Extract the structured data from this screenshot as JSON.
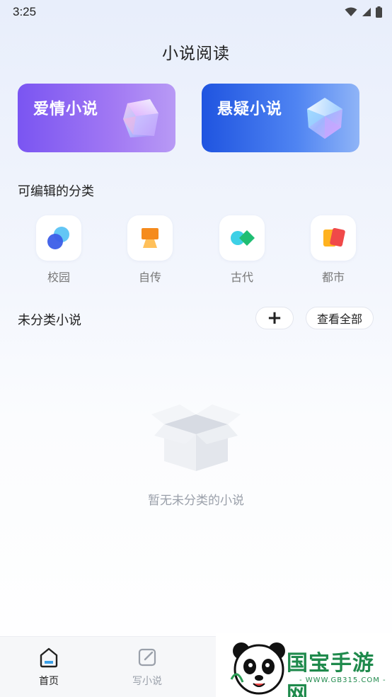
{
  "status_bar": {
    "time": "3:25"
  },
  "header": {
    "title": "小说阅读"
  },
  "hero_cards": [
    {
      "label": "爱情小说"
    },
    {
      "label": "悬疑小说"
    }
  ],
  "editable_categories": {
    "title": "可编辑的分类",
    "items": [
      {
        "label": "校园",
        "icon": "overlapping-circles-icon"
      },
      {
        "label": "自传",
        "icon": "easel-icon"
      },
      {
        "label": "古代",
        "icon": "circle-diamond-icon"
      },
      {
        "label": "都市",
        "icon": "cards-icon"
      }
    ]
  },
  "uncategorized": {
    "title": "未分类小说",
    "add_label": "+",
    "view_all_label": "查看全部",
    "empty_text": "暂无未分类的小说"
  },
  "bottom_nav": {
    "items": [
      {
        "label": "首页",
        "active": true
      },
      {
        "label": "写小说",
        "active": false
      }
    ]
  },
  "watermark": {
    "text": "国宝手游网",
    "url": "- WWW.GB315.COM -"
  },
  "colors": {
    "romance_card": "#7a55f2",
    "mystery_card": "#1f54e0",
    "active_nav": "#222222",
    "inactive_nav": "#9aa0aa"
  }
}
